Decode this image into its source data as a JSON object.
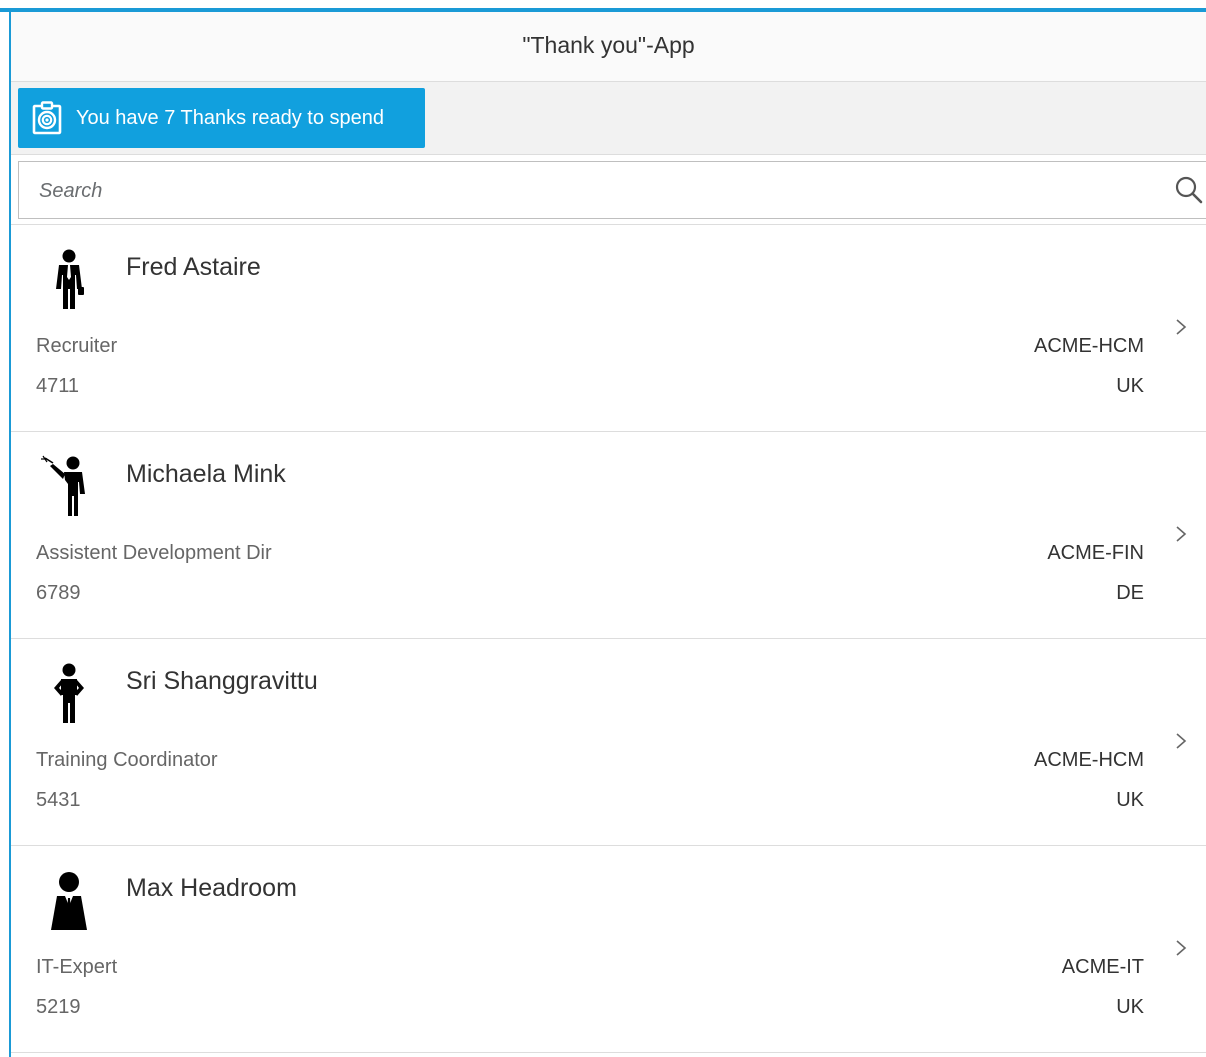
{
  "header": {
    "title": "\"Thank you\"-App"
  },
  "toolbar": {
    "thanks_button_label": "You have 7 Thanks ready to spend",
    "thanks_icon": "badge-target-icon",
    "accent_color": "#11a0de"
  },
  "search": {
    "placeholder": "Search",
    "value": "",
    "icon": "search-icon"
  },
  "employees": [
    {
      "name": "Fred Astaire",
      "role": "Recruiter",
      "id": "4711",
      "org": "ACME-HCM",
      "country": "UK",
      "avatar_icon": "businessman-icon"
    },
    {
      "name": "Michaela Mink",
      "role": "Assistent Development Dir",
      "id": "6789",
      "org": "ACME-FIN",
      "country": "DE",
      "avatar_icon": "presenter-icon"
    },
    {
      "name": "Sri Shanggravittu",
      "role": "Training Coordinator",
      "id": "5431",
      "org": "ACME-HCM",
      "country": "UK",
      "avatar_icon": "person-hands-on-hips-icon"
    },
    {
      "name": "Max Headroom",
      "role": "IT-Expert",
      "id": "5219",
      "org": "ACME-IT",
      "country": "UK",
      "avatar_icon": "manager-suit-icon"
    }
  ],
  "colors": {
    "accent": "#1a9ad6",
    "text_primary": "#333333",
    "text_secondary": "#666666",
    "divider": "#dddddd"
  }
}
